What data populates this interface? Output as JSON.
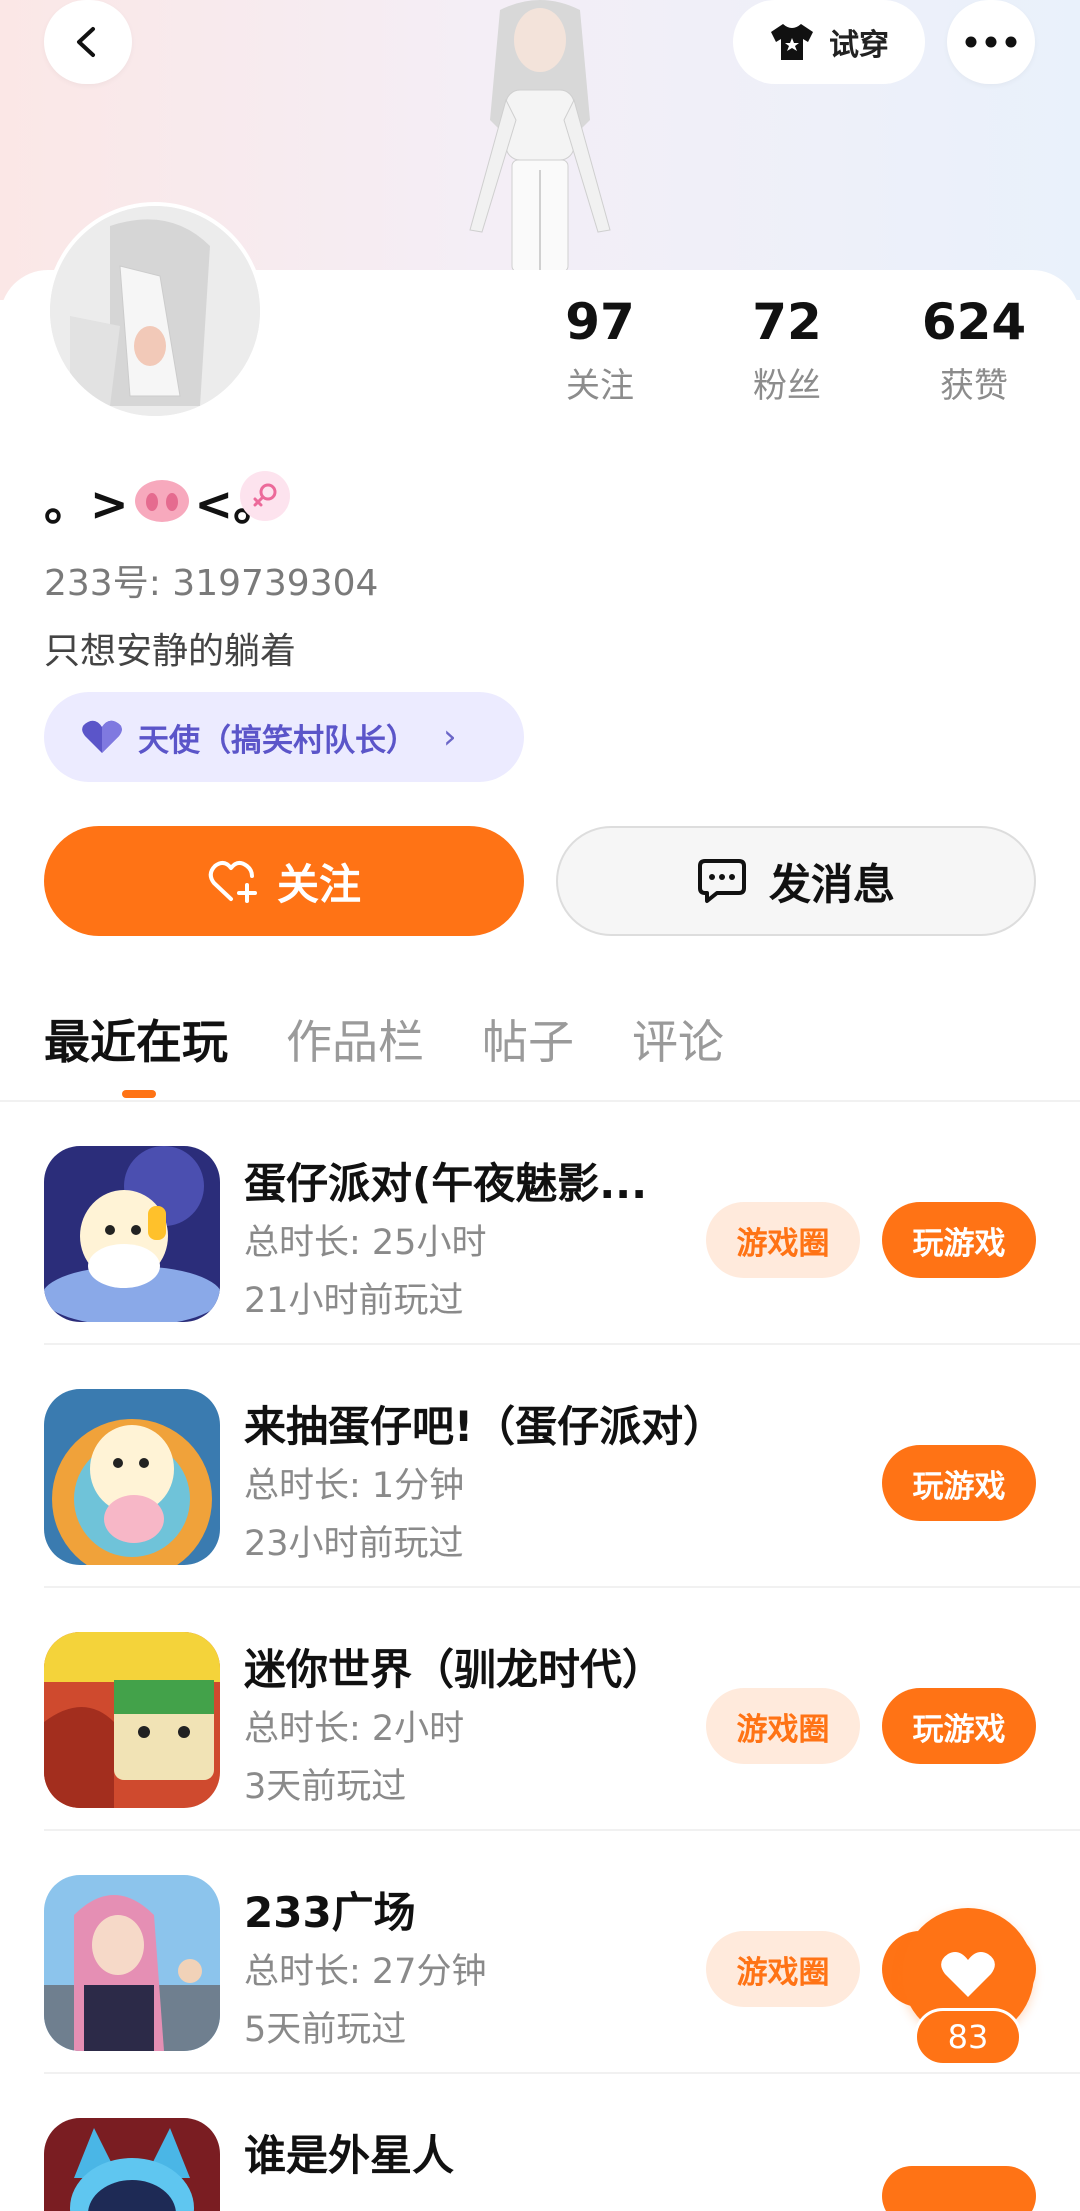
{
  "header": {
    "back_icon": "chevron-left-icon",
    "try_on_label": "试穿",
    "try_on_icon": "tshirt-icon",
    "more_icon": "more-dots-icon"
  },
  "profile": {
    "stats": [
      {
        "value": "97",
        "label": "关注"
      },
      {
        "value": "72",
        "label": "粉丝"
      },
      {
        "value": "624",
        "label": "获赞"
      }
    ],
    "nickname_left": "。>",
    "nickname_right": "<。",
    "gender": "female",
    "uid": "233号: 319739304",
    "bio": "只想安静的躺着",
    "title_badge": "天使（搞笑村队长）",
    "title_chevron": "›"
  },
  "actions": {
    "follow_label": "关注",
    "message_label": "发消息"
  },
  "tabs": [
    {
      "label": "最近在玩",
      "active": true
    },
    {
      "label": "作品栏",
      "active": false
    },
    {
      "label": "帖子",
      "active": false
    },
    {
      "label": "评论",
      "active": false
    }
  ],
  "games": [
    {
      "name": "蛋仔派对(午夜魅影...",
      "duration": "总时长: 25小时",
      "last_played": "21小时前玩过",
      "circle_label": "游戏圈",
      "play_label": "玩游戏"
    },
    {
      "name": "来抽蛋仔吧!（蛋仔派对）",
      "duration": "总时长: 1分钟",
      "last_played": "23小时前玩过",
      "play_label": "玩游戏"
    },
    {
      "name": "迷你世界（驯龙时代）",
      "duration": "总时长: 2小时",
      "last_played": "3天前玩过",
      "circle_label": "游戏圈",
      "play_label": "玩游戏"
    },
    {
      "name": "233广场",
      "duration": "总时长: 27分钟",
      "last_played": "5天前玩过",
      "circle_label": "游戏圈",
      "play_label": "玩游戏"
    },
    {
      "name": "谁是外星人",
      "duration": "",
      "last_played": ""
    }
  ],
  "like_fab": {
    "count": "83"
  },
  "colors": {
    "accent": "#ff7315",
    "badge_bg": "#ecebff",
    "badge_text": "#5b55c9"
  }
}
